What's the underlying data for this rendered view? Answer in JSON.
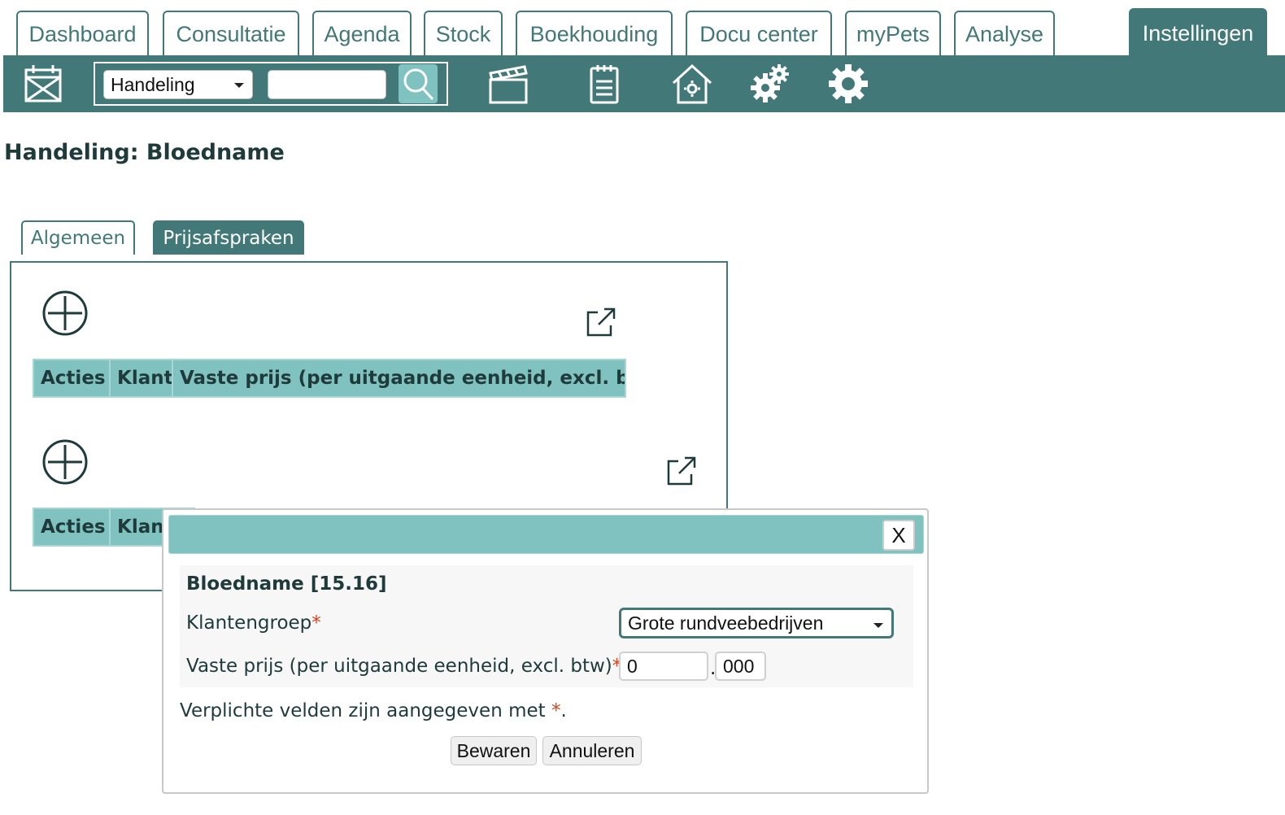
{
  "nav": {
    "tabs": [
      {
        "label": "Dashboard"
      },
      {
        "label": "Consultatie"
      },
      {
        "label": "Agenda"
      },
      {
        "label": "Stock"
      },
      {
        "label": "Boekhouding"
      },
      {
        "label": "Docu center"
      },
      {
        "label": "myPets"
      },
      {
        "label": "Analyse"
      },
      {
        "label": "Instellingen"
      }
    ],
    "active_tab": "Instellingen"
  },
  "toolbar": {
    "search_type": "Handeling",
    "search_value": "",
    "icons": [
      "calendar-icon",
      "search-icon",
      "clapperboard-icon",
      "clipboard-icon",
      "house-gear-icon",
      "gears-icon",
      "gear-icon"
    ]
  },
  "page": {
    "title": "Handeling: Bloedname"
  },
  "subtabs": [
    {
      "label": "Algemeen"
    },
    {
      "label": "Prijsafspraken"
    }
  ],
  "table1": {
    "columns": [
      "Acties",
      "Klant",
      "Vaste prijs (per uitgaande eenheid, excl. btw)"
    ]
  },
  "table2": {
    "columns": [
      "Acties",
      "Klant"
    ]
  },
  "dialog": {
    "close_label": "X",
    "heading": "Bloedname [15.16]",
    "klantengroep_label": "Klantengroep",
    "klantengroep_value": "Grote rundveebedrijven",
    "prijs_label": "Vaste prijs (per uitgaande eenheid, excl. btw)",
    "prijs_int": "0",
    "decimal_separator": ".",
    "prijs_dec": "000",
    "required_marker": "*",
    "required_note": "Verplichte velden zijn aangegeven met",
    "required_note_end": ".",
    "save_label": "Bewaren",
    "cancel_label": "Annuleren"
  },
  "colors": {
    "primary": "#437878",
    "header_teal": "#80c2c0",
    "required": "#d9401c"
  }
}
